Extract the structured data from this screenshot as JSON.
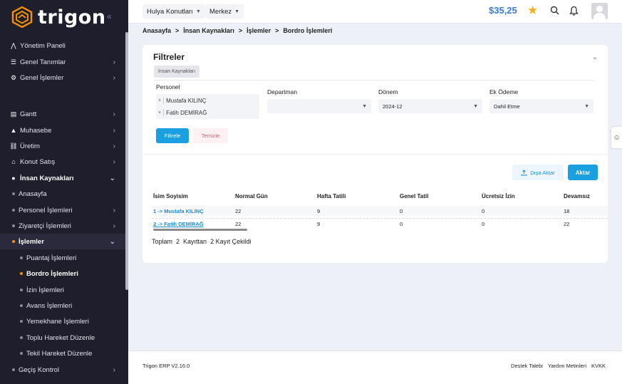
{
  "brand": {
    "name": "trigon",
    "collapse_icon": "double-chevron-left-icon"
  },
  "sidebar": {
    "items": [
      {
        "label": "Yönetim Paneli",
        "icon": "chart-line-icon"
      },
      {
        "label": "Genel Tanımlar",
        "icon": "sliders-icon"
      },
      {
        "label": "Genel İşlemler",
        "icon": "gears-icon"
      },
      {
        "label": "Gantt",
        "icon": "gantt-chart-icon"
      },
      {
        "label": "Muhasebe",
        "icon": "money-icon"
      },
      {
        "label": "Üretim",
        "icon": "production-icon"
      },
      {
        "label": "Konut Satış",
        "icon": "house-icon"
      },
      {
        "label": "İnsan Kaynakları",
        "icon": "user-icon"
      },
      {
        "label": "Anasayfa"
      },
      {
        "label": "Personel İşlemleri"
      },
      {
        "label": "Ziyaretçi İşlemleri"
      },
      {
        "label": "İşlemler"
      },
      {
        "label": "Puantaj İşlemleri"
      },
      {
        "label": "Bordro İşlemleri"
      },
      {
        "label": "İzin İşlemleri"
      },
      {
        "label": "Avans İşlemleri"
      },
      {
        "label": "Yemekhane İşlemleri"
      },
      {
        "label": "Toplu Hareket Düzenle"
      },
      {
        "label": "Tekil Hareket Düzenle"
      },
      {
        "label": "Geçiş Kontrol"
      }
    ]
  },
  "topbar": {
    "company": "Hulya Konutları",
    "branch": "Merkez",
    "balance": "$35,25",
    "accent": "#3a7bd5"
  },
  "breadcrumb": [
    "Anasayfa",
    "İnsan Kaynakları",
    "İşlemler",
    "Bordro İşlemleri"
  ],
  "filters": {
    "title": "Filtreler",
    "tab": "İnsan Kaynakları",
    "personel_label": "Personel",
    "personel_tags": [
      "Mustafa KILINÇ",
      "Fatih DEMİRAĞ"
    ],
    "departman_label": "Departman",
    "departman_value": "",
    "donem_label": "Dönem",
    "donem_value": "2024-12",
    "ek_odeme_label": "Ek Ödeme",
    "ek_odeme_value": "Dahil Etme",
    "filter_button": "Filtrele",
    "clear_button": "Temizle"
  },
  "actions": {
    "export": "Dışa Aktar",
    "transfer": "Aktar"
  },
  "table": {
    "headers": [
      "İsim Soyisim",
      "Normal Gün",
      "Hafta Tatili",
      "Genel Tatil",
      "Ücretsiz İzin",
      "Devamsız"
    ],
    "rows": [
      [
        "1 -> Mustafa KILINÇ",
        "22",
        "9",
        "0",
        "0",
        "18"
      ],
      [
        "2 -> Fatih DEMİRAĞ",
        "22",
        "9",
        "0",
        "0",
        "22"
      ]
    ]
  },
  "summary": {
    "prefix": "Toplam",
    "total": "2",
    "mid": "Kayıttan",
    "selected": "2 Kayıt Çekildi"
  },
  "footer": {
    "version": "Trigon ERP V2.16.0",
    "links": [
      "Destek Talebi",
      "Yardım Metinleri",
      "KVKK"
    ]
  }
}
